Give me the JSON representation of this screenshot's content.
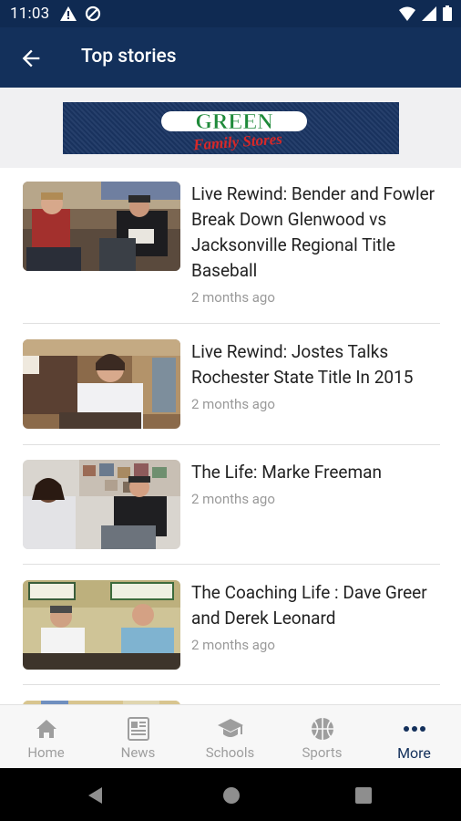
{
  "status_bar": {
    "time": "11:03"
  },
  "app_bar": {
    "title": "Top stories"
  },
  "banner": {
    "logo_line1": "GREEN",
    "logo_line2": "Family Stores"
  },
  "stories": [
    {
      "title": "Live Rewind: Bender and Fowler Break Down Glenwood vs Jacksonville Regional Title Baseball",
      "time": "2 months ago"
    },
    {
      "title": "Live Rewind: Jostes Talks Rochester State Title In 2015",
      "time": "2 months ago"
    },
    {
      "title": "The Life: Marke Freeman",
      "time": "2 months ago"
    },
    {
      "title": "The Coaching Life : Dave Greer and Derek Leonard",
      "time": "2 months ago"
    }
  ],
  "bottom_nav": [
    {
      "label": "Home",
      "icon": "home-icon"
    },
    {
      "label": "News",
      "icon": "news-icon"
    },
    {
      "label": "Schools",
      "icon": "school-icon"
    },
    {
      "label": "Sports",
      "icon": "basketball-icon"
    },
    {
      "label": "More",
      "icon": "more-icon",
      "active": true
    }
  ],
  "colors": {
    "app_bar": "#13305b",
    "status_bar": "#0f2a52",
    "active_nav": "#13305b",
    "inactive_nav": "#9e9e9e"
  }
}
